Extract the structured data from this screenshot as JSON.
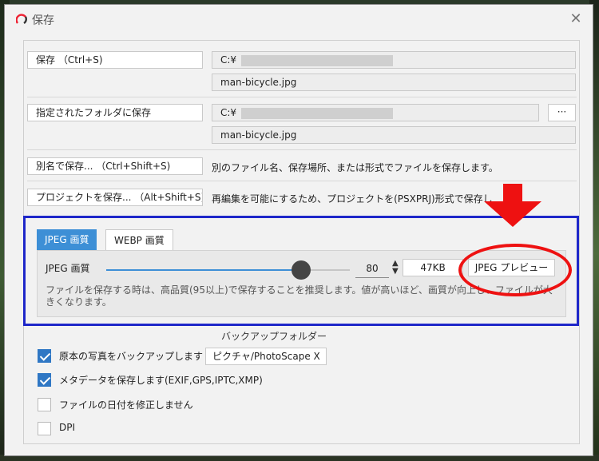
{
  "window": {
    "title": "保存"
  },
  "save": {
    "button": "保存 （Ctrl+S)",
    "path": "C:¥",
    "filename": "man-bicycle.jpg"
  },
  "save_folder": {
    "button": "指定されたフォルダに保存",
    "path": "C:¥",
    "browse": "···",
    "filename": "man-bicycle.jpg"
  },
  "save_as": {
    "button": "別名で保存... （Ctrl+Shift+S)",
    "description": "別のファイル名、保存場所、または形式でファイルを保存します。"
  },
  "save_project": {
    "button": "プロジェクトを保存... （Alt+Shift+S)",
    "description": "再編集を可能にするため、プロジェクトを(PSXPRJ)形式で保存し"
  },
  "quality": {
    "tabs": [
      "JPEG 画質",
      "WEBP 画質"
    ],
    "label": "JPEG 画質",
    "value": "80",
    "slider_fraction": 0.8,
    "file_size": "47KB",
    "preview_button": "JPEG プレビュー",
    "note": "ファイルを保存する時は、高品質(95以上)で保存することを推奨します。値が高いほど、画質が向上し、ファイルが大きくなります。"
  },
  "backup": {
    "folder_label": "バックアップフォルダー",
    "folder_value": "ピクチャ/PhotoScape X"
  },
  "options": [
    {
      "label": "原本の写真をバックアップします",
      "checked": true
    },
    {
      "label": "メタデータを保存します(EXIF,GPS,IPTC,XMP)",
      "checked": true
    },
    {
      "label": "ファイルの日付を修正しません",
      "checked": false
    },
    {
      "label": "DPI",
      "checked": false
    }
  ],
  "colors": {
    "accent": "#3d8fd6",
    "highlight_frame": "#1e27c9",
    "annotation": "#e11111"
  }
}
